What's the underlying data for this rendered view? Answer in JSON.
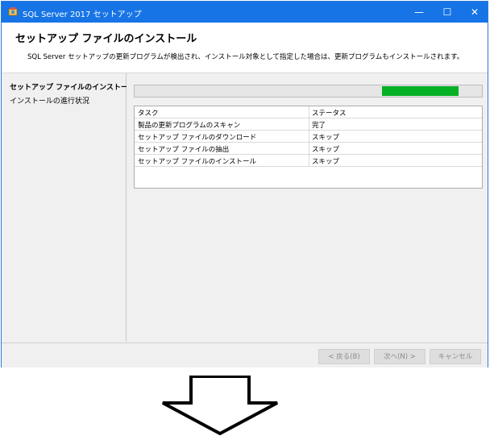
{
  "window": {
    "title": "SQL Server 2017 セットアップ",
    "controls": {
      "minimize": "—",
      "maximize": "☐",
      "close": "✕"
    }
  },
  "header": {
    "title": "セットアップ ファイルのインストール",
    "description": "SQL Server セットアップの更新プログラムが検出され、インストール対象として指定した場合は、更新プログラムもインストールされます。"
  },
  "sidebar": {
    "items": [
      {
        "label": "セットアップ ファイルのインストール",
        "active": true
      },
      {
        "label": "インストールの進行状況",
        "active": false
      }
    ]
  },
  "progress": {
    "value": 0.22
  },
  "table": {
    "headers": [
      "タスク",
      "ステータス"
    ],
    "rows": [
      [
        "製品の更新プログラムのスキャン",
        "完了"
      ],
      [
        "セットアップ ファイルのダウンロード",
        "スキップ"
      ],
      [
        "セットアップ ファイルの抽出",
        "スキップ"
      ],
      [
        "セットアップ ファイルのインストール",
        "スキップ"
      ]
    ]
  },
  "footer": {
    "back_label": "< 戻る(B)",
    "next_label": "次へ(N) >",
    "cancel_label": "キャンセル"
  },
  "colors": {
    "titlebar": "#1774e6",
    "progress_fill": "#06b025"
  }
}
